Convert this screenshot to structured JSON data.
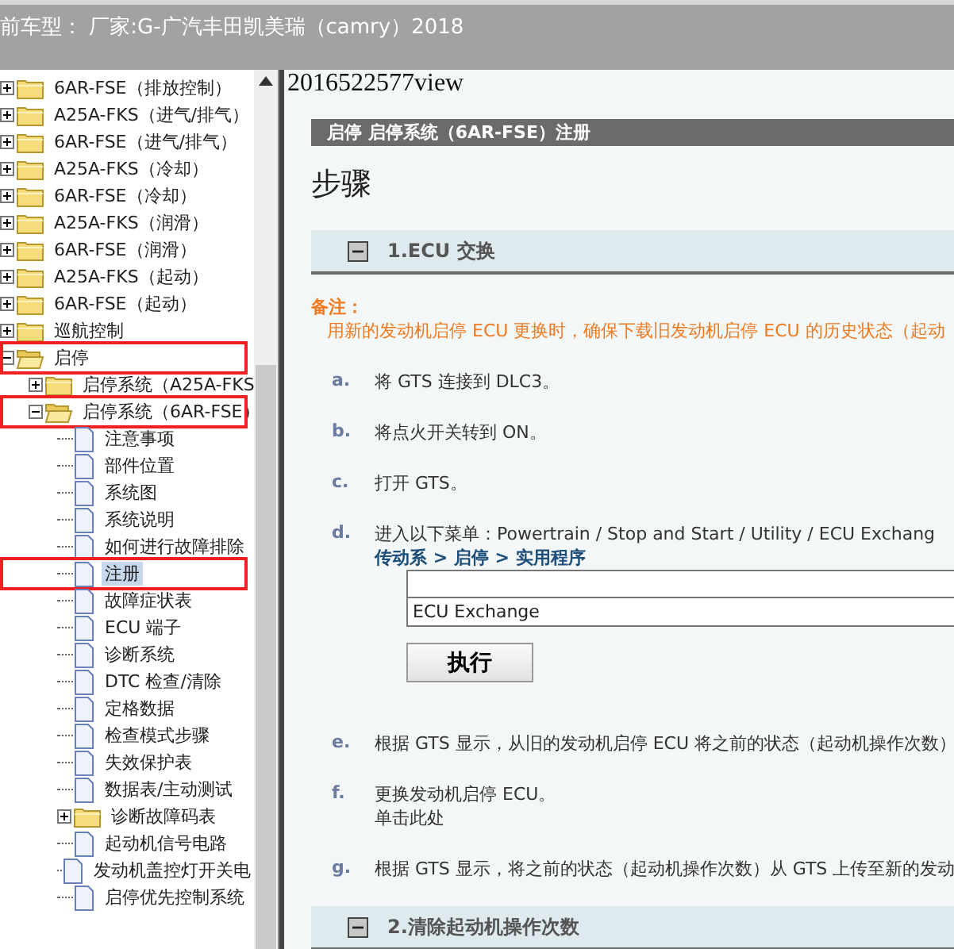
{
  "header": {
    "title": "前车型： 厂家:G-广汽丰田凯美瑞（camry）2018"
  },
  "tree": [
    {
      "label": "6AR-FSE（排放控制）",
      "kind": "folder",
      "expanded": false,
      "selected": false,
      "annotated": false
    },
    {
      "label": "A25A-FKS（进气/排气）",
      "kind": "folder",
      "expanded": false,
      "selected": false,
      "annotated": false
    },
    {
      "label": "6AR-FSE（进气/排气）",
      "kind": "folder",
      "expanded": false,
      "selected": false,
      "annotated": false
    },
    {
      "label": "A25A-FKS（冷却）",
      "kind": "folder",
      "expanded": false,
      "selected": false,
      "annotated": false
    },
    {
      "label": "6AR-FSE（冷却）",
      "kind": "folder",
      "expanded": false,
      "selected": false,
      "annotated": false
    },
    {
      "label": "A25A-FKS（润滑）",
      "kind": "folder",
      "expanded": false,
      "selected": false,
      "annotated": false
    },
    {
      "label": "6AR-FSE（润滑）",
      "kind": "folder",
      "expanded": false,
      "selected": false,
      "annotated": false
    },
    {
      "label": "A25A-FKS（起动）",
      "kind": "folder",
      "expanded": false,
      "selected": false,
      "annotated": false
    },
    {
      "label": "6AR-FSE（起动）",
      "kind": "folder",
      "expanded": false,
      "selected": false,
      "annotated": false
    },
    {
      "label": "巡航控制",
      "kind": "folder",
      "expanded": false,
      "selected": false,
      "annotated": false
    },
    {
      "label": "启停",
      "kind": "folder",
      "expanded": true,
      "selected": false,
      "annotated": true,
      "children": [
        {
          "label": "启停系统（A25A-FKS",
          "kind": "folder",
          "expanded": false,
          "selected": false,
          "annotated": false
        },
        {
          "label": "启停系统（6AR-FSE）",
          "kind": "folder",
          "expanded": true,
          "selected": false,
          "annotated": true,
          "children": [
            {
              "label": "注意事项",
              "kind": "page",
              "selected": false,
              "annotated": false
            },
            {
              "label": "部件位置",
              "kind": "page",
              "selected": false,
              "annotated": false
            },
            {
              "label": "系统图",
              "kind": "page",
              "selected": false,
              "annotated": false
            },
            {
              "label": "系统说明",
              "kind": "page",
              "selected": false,
              "annotated": false
            },
            {
              "label": "如何进行故障排除",
              "kind": "page",
              "selected": false,
              "annotated": false
            },
            {
              "label": "注册",
              "kind": "page",
              "selected": true,
              "annotated": true
            },
            {
              "label": "故障症状表",
              "kind": "page",
              "selected": false,
              "annotated": false
            },
            {
              "label": "ECU 端子",
              "kind": "page",
              "selected": false,
              "annotated": false
            },
            {
              "label": "诊断系统",
              "kind": "page",
              "selected": false,
              "annotated": false
            },
            {
              "label": "DTC 检查/清除",
              "kind": "page",
              "selected": false,
              "annotated": false
            },
            {
              "label": "定格数据",
              "kind": "page",
              "selected": false,
              "annotated": false
            },
            {
              "label": "检查模式步骤",
              "kind": "page",
              "selected": false,
              "annotated": false
            },
            {
              "label": "失效保护表",
              "kind": "page",
              "selected": false,
              "annotated": false
            },
            {
              "label": "数据表/主动测试",
              "kind": "page",
              "selected": false,
              "annotated": false
            },
            {
              "label": "诊断故障码表",
              "kind": "folder",
              "expanded": false,
              "selected": false,
              "annotated": false
            },
            {
              "label": "起动机信号电路",
              "kind": "page",
              "selected": false,
              "annotated": false
            },
            {
              "label": "发动机盖控灯开关电",
              "kind": "page",
              "selected": false,
              "annotated": false
            },
            {
              "label": "启停优先控制系统",
              "kind": "page",
              "selected": false,
              "annotated": false
            }
          ]
        }
      ]
    }
  ],
  "content": {
    "doc_id": "2016522577view",
    "breadcrumb": "启停  启停系统（6AR-FSE）注册",
    "heading": "步骤",
    "sections": [
      {
        "title": "1.ECU 交换",
        "expanded": true,
        "note_label": "备注：",
        "note": "用新的发动机启停 ECU 更换时，确保下载旧发动机启停 ECU 的历史状态（起动",
        "steps": [
          {
            "marker": "a.",
            "text": "将 GTS 连接到 DLC3。"
          },
          {
            "marker": "b.",
            "text": "将点火开关转到 ON。"
          },
          {
            "marker": "c.",
            "text": "打开 GTS。"
          },
          {
            "marker": "d.",
            "text": "进入以下菜单：Powertrain / Stop and Start / Utility / ECU Exchang",
            "path": "传动系 > 启停 > 实用程序",
            "table_row": "ECU Exchange",
            "button": "执行"
          },
          {
            "marker": "e.",
            "text": "根据 GTS 显示，从旧的发动机启停 ECU 将之前的状态（起动机操作次数）"
          },
          {
            "marker": "f.",
            "text": "更换发动机启停 ECU。",
            "link": "单击此处"
          },
          {
            "marker": "g.",
            "text": "根据 GTS 显示，将之前的状态（起动机操作次数）从 GTS 上传至新的发动"
          }
        ]
      },
      {
        "title": "2.清除起动机操作次数",
        "expanded": true
      }
    ]
  }
}
